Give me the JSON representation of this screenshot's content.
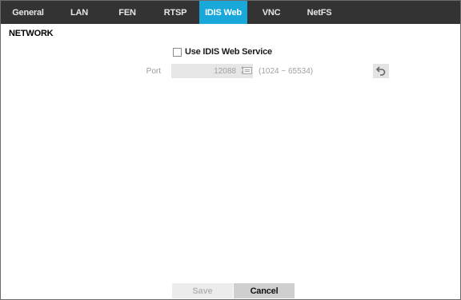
{
  "tabs": [
    {
      "label": "General",
      "active": false
    },
    {
      "label": "LAN",
      "active": false
    },
    {
      "label": "FEN",
      "active": false
    },
    {
      "label": "RTSP",
      "active": false
    },
    {
      "label": "IDIS Web",
      "active": true
    },
    {
      "label": "VNC",
      "active": false
    },
    {
      "label": "NetFS",
      "active": false
    }
  ],
  "section": {
    "title": "NETWORK"
  },
  "use_web_service": {
    "label": "Use IDIS Web Service",
    "checked": false
  },
  "port": {
    "label": "Port",
    "value": "12088",
    "range": "(1024 ~ 65534)",
    "enabled": false
  },
  "buttons": {
    "save": "Save",
    "cancel": "Cancel"
  },
  "colors": {
    "tab_bar": "#333333",
    "tab_active": "#18a9da",
    "disabled_text": "#a0a0a0"
  },
  "icons": {
    "spinner": "up-down-arrows-icon",
    "keyboard": "keyboard-icon",
    "undo": "undo-arrow-icon"
  }
}
